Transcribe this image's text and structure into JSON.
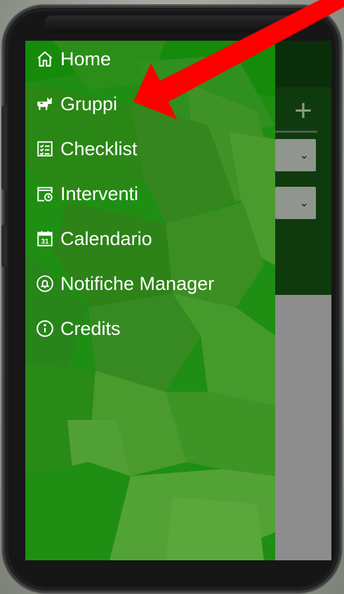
{
  "drawer": {
    "items": [
      {
        "label": "Home",
        "icon": "home-icon"
      },
      {
        "label": "Gruppi",
        "icon": "cow-icon"
      },
      {
        "label": "Checklist",
        "icon": "checklist-icon"
      },
      {
        "label": "Interventi",
        "icon": "intervention-clock-icon"
      },
      {
        "label": "Calendario",
        "icon": "calendar-icon"
      },
      {
        "label": "Notifiche Manager",
        "icon": "bell-icon"
      },
      {
        "label": "Credits",
        "icon": "info-icon"
      }
    ],
    "calendar_day": "31"
  },
  "app": {
    "add_glyph": "+"
  },
  "colors": {
    "drawer_green": "#1e8f12",
    "arrow_red": "#ff0000",
    "header_dark_green": "#0f3a0d"
  }
}
